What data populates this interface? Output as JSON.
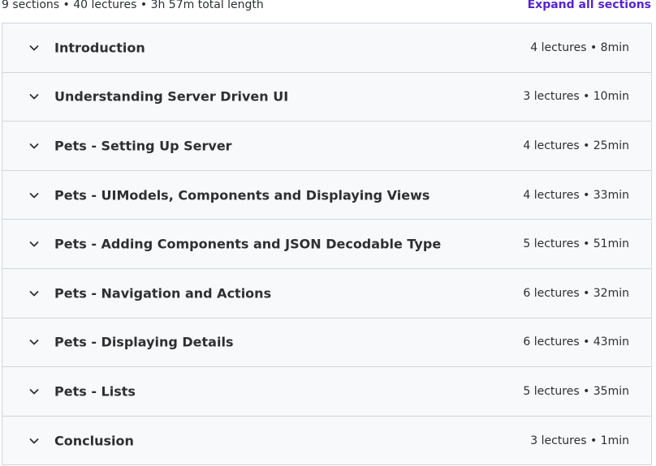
{
  "summary": {
    "text": "9 sections • 40 lectures • 3h 57m total length",
    "expand_all_label": "Expand all sections"
  },
  "colors": {
    "accent": "#5624d0",
    "section_bg": "#f7f9fa",
    "border": "#d1d7dc",
    "text": "#2d2f31"
  },
  "icons": {
    "section_toggle": "chevron-down-icon"
  },
  "sections": [
    {
      "title": "Introduction",
      "meta": "4 lectures • 8min"
    },
    {
      "title": "Understanding Server Driven UI",
      "meta": "3 lectures • 10min"
    },
    {
      "title": "Pets - Setting Up Server",
      "meta": "4 lectures • 25min"
    },
    {
      "title": "Pets - UIModels, Components and Displaying Views",
      "meta": "4 lectures • 33min"
    },
    {
      "title": "Pets - Adding Components and JSON Decodable Type",
      "meta": "5 lectures • 51min"
    },
    {
      "title": "Pets - Navigation and Actions",
      "meta": "6 lectures • 32min"
    },
    {
      "title": "Pets - Displaying Details",
      "meta": "6 lectures • 43min"
    },
    {
      "title": "Pets - Lists",
      "meta": "5 lectures • 35min"
    },
    {
      "title": "Conclusion",
      "meta": "3 lectures • 1min"
    }
  ]
}
